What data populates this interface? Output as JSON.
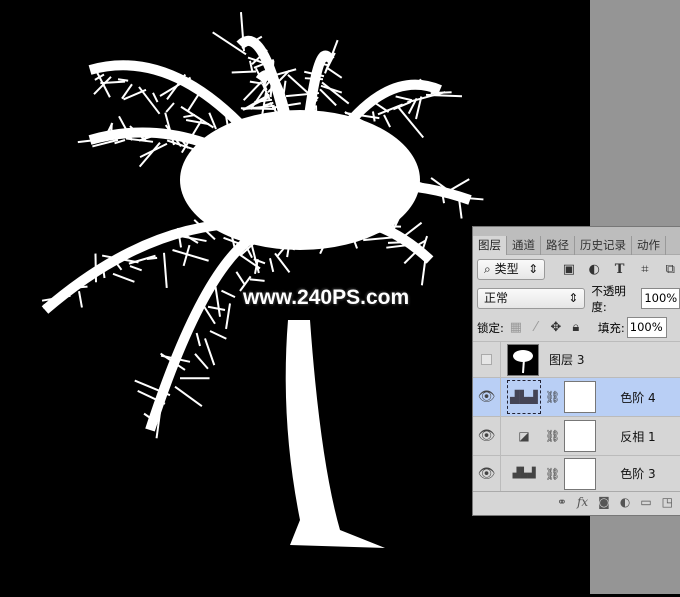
{
  "canvas": {
    "watermark": "www.240PS.com",
    "background": "#000000",
    "subject_color": "#ffffff"
  },
  "layers_panel": {
    "tabs": [
      {
        "label": "图层",
        "active": true
      },
      {
        "label": "通道"
      },
      {
        "label": "路径"
      },
      {
        "label": "历史记录"
      },
      {
        "label": "动作"
      }
    ],
    "filter": {
      "icon": "search-icon",
      "label": "类型"
    },
    "filter_icons": [
      "image-filter-icon",
      "adjustment-filter-icon",
      "text-filter-icon",
      "shape-filter-icon",
      "smart-object-filter-icon"
    ],
    "blend_mode": "正常",
    "opacity_label": "不透明度:",
    "opacity": "100%",
    "lock_label": "锁定:",
    "fill_label": "填充:",
    "fill": "100%",
    "layers": [
      {
        "name": "图层 3",
        "visible": false,
        "type": "pixel"
      },
      {
        "name": "色阶 4",
        "visible": true,
        "type": "levels",
        "selected": true
      },
      {
        "name": "反相 1",
        "visible": true,
        "type": "invert"
      },
      {
        "name": "色阶 3",
        "visible": true,
        "type": "levels"
      }
    ],
    "selected_color": "#b9cff5",
    "bottom_icons": [
      "link-icon",
      "fx-icon",
      "mask-icon",
      "adjustment-icon",
      "folder-icon",
      "new-layer-icon"
    ]
  }
}
